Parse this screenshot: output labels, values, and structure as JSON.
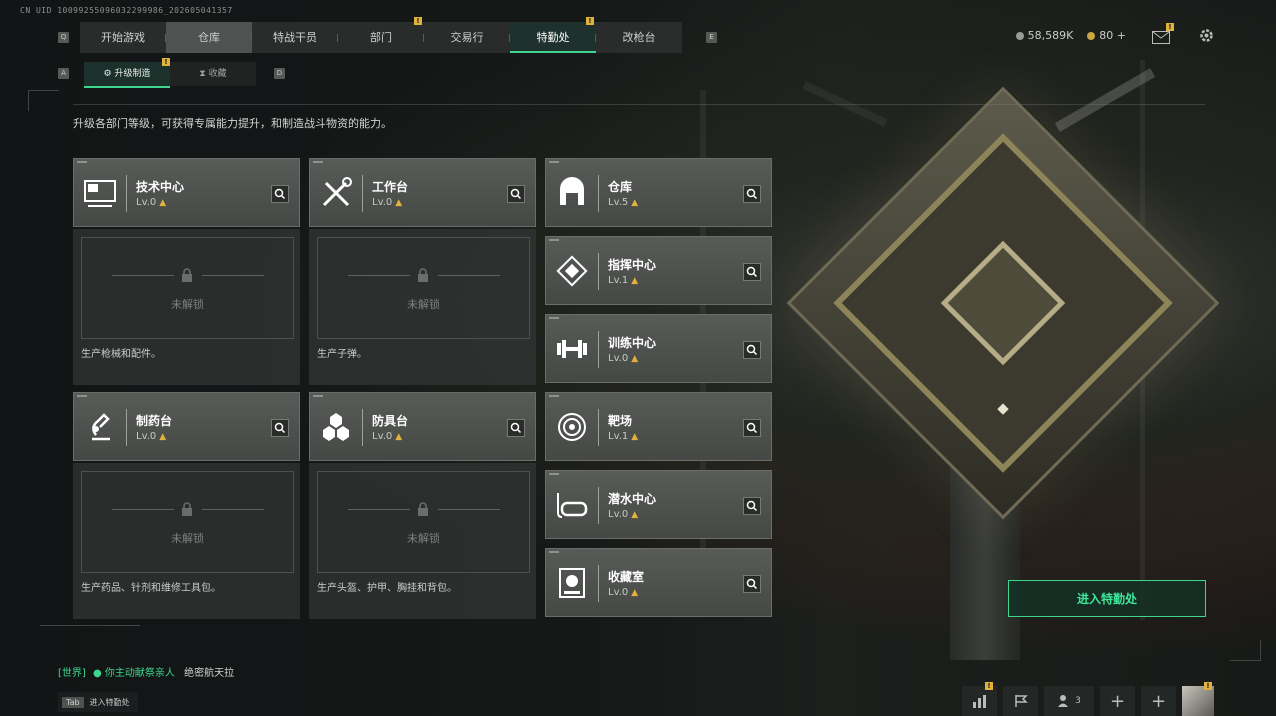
{
  "uid": "CN UID 10099255096032299986_202605041357",
  "nav": {
    "key_left": "Q",
    "key_right": "E",
    "tabs": [
      {
        "label": "开始游戏",
        "badge": ""
      },
      {
        "label": "仓库",
        "badge": ""
      },
      {
        "label": "特战干员",
        "badge": ""
      },
      {
        "label": "部门",
        "badge": "!"
      },
      {
        "label": "交易行",
        "badge": ""
      },
      {
        "label": "特勤处",
        "badge": "!"
      },
      {
        "label": "改枪台",
        "badge": ""
      }
    ],
    "active_tab": "特勤处"
  },
  "currency": {
    "silver": "58,589K",
    "gold": "80",
    "add": "+"
  },
  "top_icons": {
    "mail_badge": "!"
  },
  "subnav": {
    "key_left": "A",
    "key_right": "D",
    "tabs": [
      {
        "label": "升级制造",
        "badge": "!"
      },
      {
        "label": "收藏",
        "badge": ""
      }
    ]
  },
  "description": "升级各部门等级，可获得专属能力提升，和制造战斗物资的能力。",
  "locked_text": "未解锁",
  "departments": [
    {
      "name": "技术中心",
      "level": "Lv.0",
      "icon": "monitor-icon",
      "product": "生产枪械和配件。"
    },
    {
      "name": "工作台",
      "level": "Lv.0",
      "icon": "tools-icon",
      "product": "生产子弹。"
    },
    {
      "name": "仓库",
      "level": "Lv.5",
      "icon": "warehouse-icon"
    },
    {
      "name": "指挥中心",
      "level": "Lv.1",
      "icon": "command-icon"
    },
    {
      "name": "训练中心",
      "level": "Lv.0",
      "icon": "dumbbell-icon"
    },
    {
      "name": "制药台",
      "level": "Lv.0",
      "icon": "microscope-icon",
      "product": "生产药品、针剂和维修工具包。"
    },
    {
      "name": "防具台",
      "level": "Lv.0",
      "icon": "hexagons-icon",
      "product": "生产头盔、护甲、胸挂和背包。"
    },
    {
      "name": "靶场",
      "level": "Lv.1",
      "icon": "target-icon"
    },
    {
      "name": "潜水中心",
      "level": "Lv.0",
      "icon": "diving-mask-icon"
    },
    {
      "name": "收藏室",
      "level": "Lv.0",
      "icon": "collection-icon"
    }
  ],
  "enter_button": "进入特勤处",
  "chat": {
    "channel": "[世界]",
    "sender": "你主动献祭亲人",
    "message": "绝密航天拉"
  },
  "tab_hint": {
    "key": "Tab",
    "label": "进入特勤处"
  },
  "bottom_bar": {
    "friends_count": "3"
  },
  "colors": {
    "accent": "#3ed58e",
    "badge": "#e0b13c",
    "card": "#505350"
  }
}
